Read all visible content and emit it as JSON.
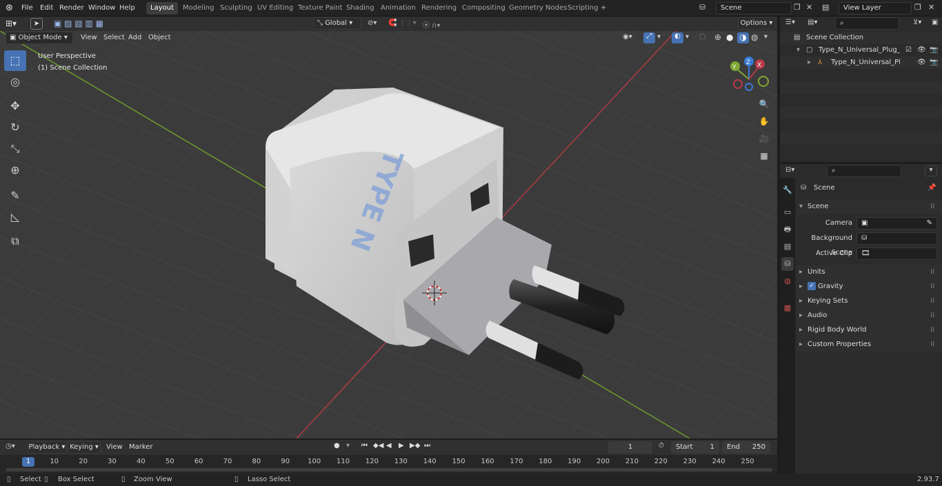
{
  "topbar": {
    "menus": [
      "File",
      "Edit",
      "Render",
      "Window",
      "Help"
    ],
    "workspaces": [
      "Layout",
      "Modeling",
      "Sculpting",
      "UV Editing",
      "Texture Paint",
      "Shading",
      "Animation",
      "Rendering",
      "Compositing",
      "Geometry Nodes",
      "Scripting"
    ],
    "active_workspace": "Layout",
    "add_tab": "+",
    "scene_name": "Scene",
    "view_layer": "View Layer"
  },
  "viewport_header": {
    "mode": "Object Mode",
    "menus": [
      "View",
      "Select",
      "Add",
      "Object"
    ],
    "orientation": "Global",
    "options": "Options"
  },
  "viewport": {
    "perspective": "User Perspective",
    "collection": "(1) Scene Collection",
    "model_label": "TYPE N",
    "axis_x": "X",
    "axis_y": "Y",
    "axis_z": "Z"
  },
  "outliner": {
    "root": "Scene Collection",
    "items": [
      "Type_N_Universal_Plug_Adap",
      "Type_N_Universal_Plug_A"
    ]
  },
  "properties": {
    "header": "Scene",
    "panel": "Scene",
    "camera_label": "Camera",
    "background_label": "Background Scene",
    "clip_label": "Active Clip",
    "sections": [
      "Units",
      "Gravity",
      "Keying Sets",
      "Audio",
      "Rigid Body World",
      "Custom Properties"
    ]
  },
  "timeline": {
    "menus": [
      "Playback",
      "Keying",
      "View",
      "Marker"
    ],
    "current_frame": "1",
    "start_label": "Start",
    "start": "1",
    "end_label": "End",
    "end": "250",
    "ticks": [
      "1",
      "10",
      "20",
      "30",
      "40",
      "50",
      "60",
      "70",
      "80",
      "90",
      "100",
      "110",
      "120",
      "130",
      "140",
      "150",
      "160",
      "170",
      "180",
      "190",
      "200",
      "210",
      "220",
      "230",
      "240",
      "250"
    ]
  },
  "status": {
    "select": "Select",
    "box_select": "Box Select",
    "zoom_view": "Zoom View",
    "lasso_select": "Lasso Select",
    "version": "2.93.7"
  },
  "colors": {
    "accent": "#4772b3",
    "x_axis": "#b83a4a",
    "y_axis": "#7fa832",
    "z_axis": "#3a7bd5"
  }
}
